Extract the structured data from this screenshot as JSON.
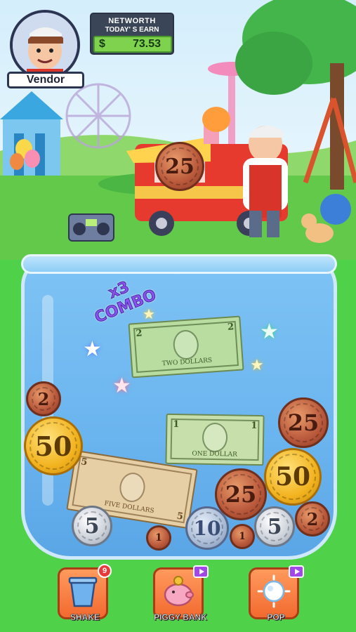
{
  "hud": {
    "vendor_label": "Vendor",
    "networth_title": "NETWORTH",
    "today_earn_label": "TODAY' S EARN",
    "currency_symbol": "$",
    "today_earn_value": "73.53"
  },
  "scene": {
    "coin_popup_value": "25"
  },
  "jar": {
    "combo_multiplier": "x3",
    "combo_label": "COMBO",
    "bills": [
      {
        "value": "2",
        "label": "TWO DOLLARS",
        "color": "#b9dca0"
      },
      {
        "value": "1",
        "label": "ONE DOLLAR",
        "color": "#c7e0ab"
      },
      {
        "value": "5",
        "label": "FIVE DOLLARS",
        "color": "#e6cfa5"
      }
    ],
    "coins": [
      {
        "value": "2",
        "type": "copper"
      },
      {
        "value": "50",
        "type": "gold"
      },
      {
        "value": "25",
        "type": "copper"
      },
      {
        "value": "50",
        "type": "gold"
      },
      {
        "value": "25",
        "type": "copper"
      },
      {
        "value": "2",
        "type": "copper"
      },
      {
        "value": "5",
        "type": "silver"
      },
      {
        "value": "10",
        "type": "blue"
      },
      {
        "value": "5",
        "type": "silver"
      },
      {
        "value": "1",
        "type": "copper"
      },
      {
        "value": "1",
        "type": "copper"
      }
    ]
  },
  "actions": {
    "shake_label": "SHAKE",
    "shake_badge": "9",
    "piggy_bank_label": "PIGGY BANK",
    "pop_label": "POP"
  },
  "colors": {
    "sky": "#b9e4f7",
    "grass": "#63c94b",
    "background": "#4fd24a",
    "button": "#f26a2f",
    "combo": "#8a52ee"
  }
}
